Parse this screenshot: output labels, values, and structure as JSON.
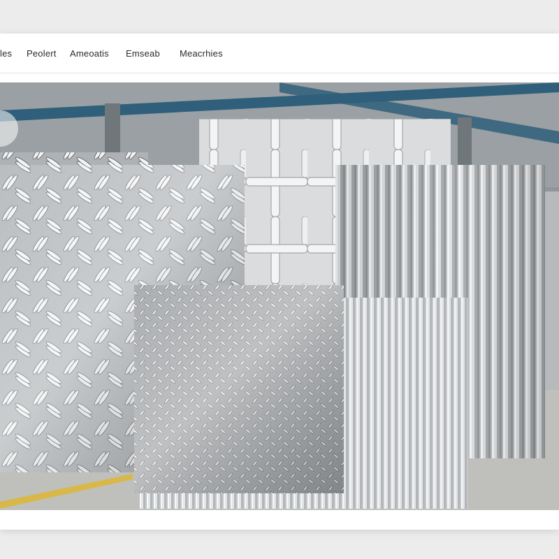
{
  "nav": {
    "items": [
      {
        "label": "les"
      },
      {
        "label": "Peolert"
      },
      {
        "label": "Ameoatis"
      },
      {
        "label": "Emseab"
      },
      {
        "label": "Meacrhies"
      }
    ]
  },
  "hero": {
    "scene": "warehouse",
    "panels": [
      {
        "name": "diamond-tread-plate-large",
        "pattern": "diamond-tread"
      },
      {
        "name": "cross-embossed-plate",
        "pattern": "cross-embossed"
      },
      {
        "name": "corrugated-sheet-right",
        "pattern": "corrugated"
      },
      {
        "name": "fine-tread-plate",
        "pattern": "fine-diamond-tread"
      },
      {
        "name": "corrugated-sheet-front",
        "pattern": "corrugated"
      }
    ]
  },
  "colors": {
    "frame_bg": "#ffffff",
    "page_bg": "#ececec",
    "steel_beam": "#2f5f7a",
    "floor_line": "#d9b84a",
    "metal_light": "#e6e8ea",
    "metal_dark": "#7c8084"
  }
}
